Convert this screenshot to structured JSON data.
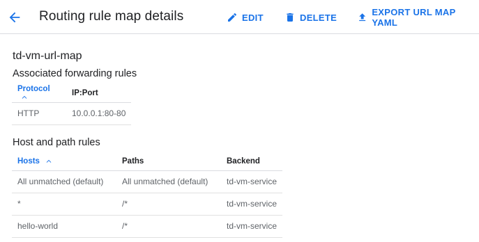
{
  "header": {
    "title": "Routing rule map details",
    "actions": {
      "edit": "EDIT",
      "delete": "DELETE",
      "export": "EXPORT URL MAP YAML"
    }
  },
  "map_name": "td-vm-url-map",
  "forwarding": {
    "title": "Associated forwarding rules",
    "columns": [
      "Protocol",
      "IP:Port"
    ],
    "rows": [
      {
        "protocol": "HTTP",
        "ip_port": "10.0.0.1:80-80"
      }
    ]
  },
  "host_path": {
    "title": "Host and path rules",
    "columns": [
      "Hosts",
      "Paths",
      "Backend"
    ],
    "rows": [
      {
        "hosts": "All unmatched (default)",
        "paths": "All unmatched (default)",
        "backend": "td-vm-service"
      },
      {
        "hosts": "*",
        "paths": "/*",
        "backend": "td-vm-service"
      },
      {
        "hosts": "hello-world",
        "paths": "/*",
        "backend": "td-vm-service"
      }
    ]
  },
  "colors": {
    "accent": "#1a73e8",
    "text": "#202124",
    "muted": "#5f6368",
    "divider": "#dadce0"
  },
  "icons": {
    "back": "arrow-back-icon",
    "edit": "pencil-icon",
    "delete": "trash-icon",
    "export": "upload-icon",
    "sort": "arrow-up-icon"
  }
}
